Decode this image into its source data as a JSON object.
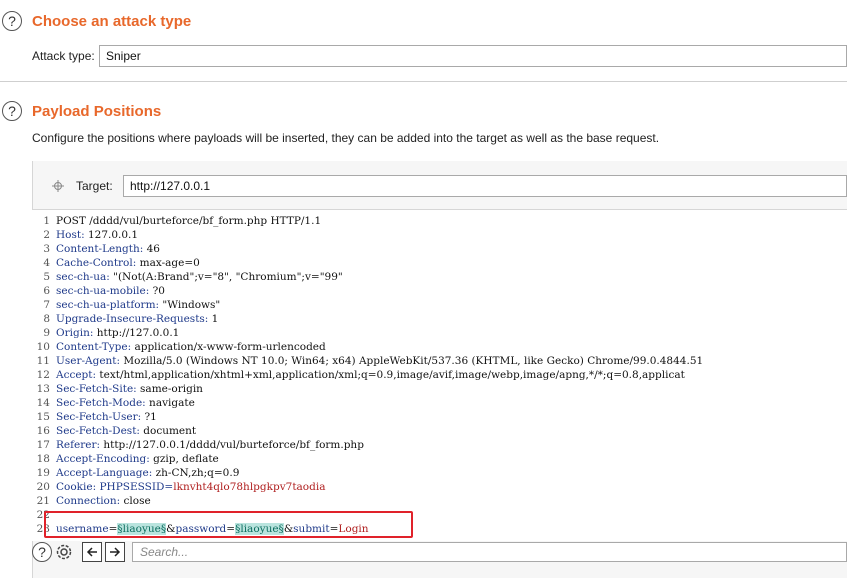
{
  "attack_type_section": {
    "title": "Choose an attack type",
    "label": "Attack type:",
    "value": "Sniper"
  },
  "positions_section": {
    "title": "Payload Positions",
    "description": "Configure the positions where payloads will be inserted, they can be added into the target as well as the base request."
  },
  "target": {
    "label": "Target:",
    "value": "http://127.0.0.1"
  },
  "request": {
    "lines": [
      {
        "n": "1",
        "name": "",
        "value": "POST /dddd/vul/burteforce/bf_form.php HTTP/1.1"
      },
      {
        "n": "2",
        "name": "Host:",
        "value": " 127.0.0.1"
      },
      {
        "n": "3",
        "name": "Content-Length:",
        "value": " 46"
      },
      {
        "n": "4",
        "name": "Cache-Control:",
        "value": " max-age=0"
      },
      {
        "n": "5",
        "name": "sec-ch-ua:",
        "value": " \"(Not(A:Brand\";v=\"8\", \"Chromium\";v=\"99\""
      },
      {
        "n": "6",
        "name": "sec-ch-ua-mobile:",
        "value": " ?0"
      },
      {
        "n": "7",
        "name": "sec-ch-ua-platform:",
        "value": " \"Windows\""
      },
      {
        "n": "8",
        "name": "Upgrade-Insecure-Requests:",
        "value": " 1"
      },
      {
        "n": "9",
        "name": "Origin:",
        "value": " http://127.0.0.1"
      },
      {
        "n": "10",
        "name": "Content-Type:",
        "value": " application/x-www-form-urlencoded"
      },
      {
        "n": "11",
        "name": "User-Agent:",
        "value": " Mozilla/5.0 (Windows NT 10.0; Win64; x64) AppleWebKit/537.36 (KHTML, like Gecko) Chrome/99.0.4844.51"
      },
      {
        "n": "12",
        "name": "Accept:",
        "value": " text/html,application/xhtml+xml,application/xml;q=0.9,image/avif,image/webp,image/apng,*/*;q=0.8,applicat"
      },
      {
        "n": "13",
        "name": "Sec-Fetch-Site:",
        "value": " same-origin"
      },
      {
        "n": "14",
        "name": "Sec-Fetch-Mode:",
        "value": " navigate"
      },
      {
        "n": "15",
        "name": "Sec-Fetch-User:",
        "value": " ?1"
      },
      {
        "n": "16",
        "name": "Sec-Fetch-Dest:",
        "value": " document"
      },
      {
        "n": "17",
        "name": "Referer:",
        "value": " http://127.0.0.1/dddd/vul/burteforce/bf_form.php"
      },
      {
        "n": "18",
        "name": "Accept-Encoding:",
        "value": " gzip, deflate"
      },
      {
        "n": "19",
        "name": "Accept-Language:",
        "value": " zh-CN,zh;q=0.9"
      },
      {
        "n": "20",
        "name": "Cookie:",
        "value": " PHPSESSID=",
        "cookie_value": "lknvht4qlo78hlpgkpv7taodia"
      },
      {
        "n": "21",
        "name": "Connection:",
        "value": " close"
      },
      {
        "n": "22",
        "name": "",
        "value": ""
      }
    ],
    "body_line": {
      "n": "23",
      "p1_name": "username",
      "eq": "=",
      "p1_payload": "§liaoyue§",
      "amp1": "&",
      "p2_name": "password",
      "p2_payload": "§liaoyue§",
      "amp2": "&",
      "p3_name": "submit",
      "p3_value": "Login"
    }
  },
  "search": {
    "placeholder": "Search..."
  },
  "icons": {
    "help": "question-mark-icon",
    "settings": "gear-icon",
    "back": "arrow-left-icon",
    "forward": "arrow-right-icon",
    "target": "crosshair-icon"
  },
  "colors": {
    "section_title": "#e8682b",
    "header_name": "#1f3a8a",
    "cookie_value": "#b02020",
    "payload_bg": "#b9e4de",
    "highlight_box": "#e0222a"
  }
}
